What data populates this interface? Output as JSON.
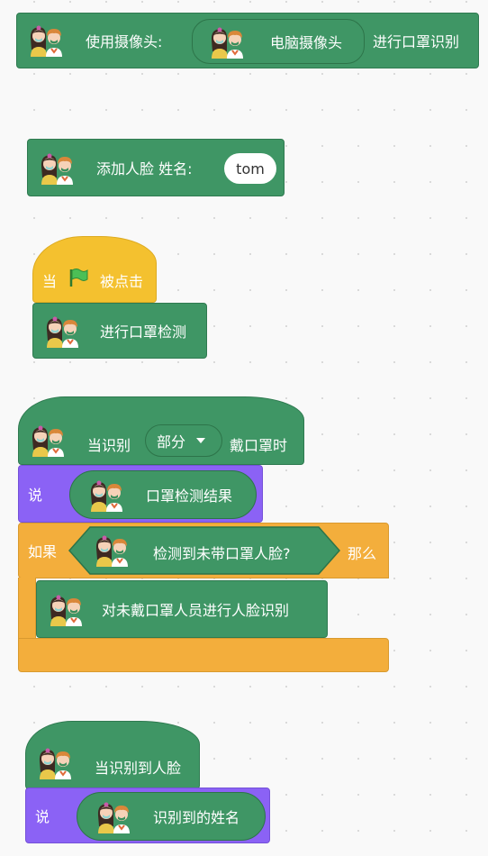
{
  "block1": {
    "prefix": "使用摄像头:",
    "camera": "电脑摄像头",
    "suffix": "进行口罩识别"
  },
  "block2": {
    "label": "添加人脸 姓名:",
    "name_value": "tom"
  },
  "block3": {
    "hat_when": "当",
    "hat_clicked": "被点击",
    "action": "进行口罩检测"
  },
  "block4": {
    "when": "当识别",
    "option": "部分",
    "suffix": "戴口罩时"
  },
  "block5": {
    "say": "说",
    "reporter": "口罩检测结果"
  },
  "block6": {
    "if": "如果",
    "condition": "检测到未带口罩人脸?",
    "then": "那么",
    "inner": "对未戴口罩人员进行人脸识别"
  },
  "block7": {
    "label": "当识别到人脸"
  },
  "block8": {
    "say": "说",
    "reporter": "识别到的姓名"
  },
  "colors": {
    "green": "#3f9665",
    "purple": "#8b62f5",
    "orange": "#f3ae3c",
    "yellow": "#f4c12f"
  }
}
